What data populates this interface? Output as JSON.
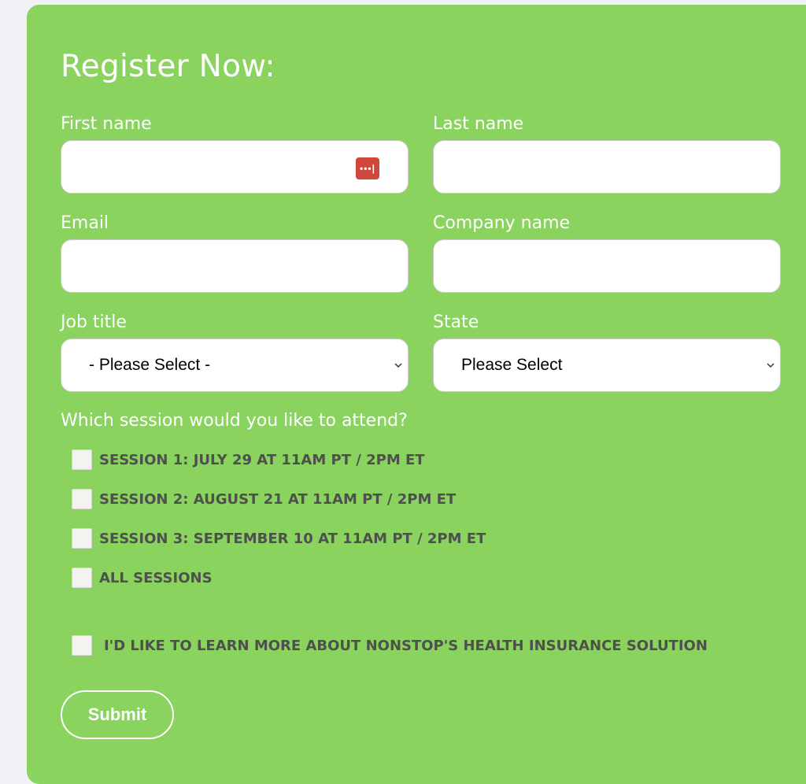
{
  "form": {
    "title": "Register Now:",
    "first_name": {
      "label": "First name",
      "value": "",
      "placeholder": ""
    },
    "last_name": {
      "label": "Last name",
      "value": "",
      "placeholder": ""
    },
    "email": {
      "label": "Email",
      "value": "",
      "placeholder": ""
    },
    "company": {
      "label": "Company name",
      "value": "",
      "placeholder": ""
    },
    "job_title": {
      "label": "Job title",
      "selected": "- Please Select -"
    },
    "state": {
      "label": "State",
      "selected": "Please Select"
    },
    "session_question": "Which session would you like to attend?",
    "sessions": [
      {
        "label": "SESSION 1: JULY 29 AT 11AM PT / 2PM ET",
        "checked": false
      },
      {
        "label": "SESSION 2: AUGUST 21 AT 11AM PT / 2PM ET",
        "checked": false
      },
      {
        "label": "SESSION 3: SEPTEMBER 10 AT 11AM PT / 2PM ET",
        "checked": false
      },
      {
        "label": "ALL SESSIONS",
        "checked": false
      }
    ],
    "learn_more": {
      "label": "I'D LIKE TO LEARN MORE ABOUT NONSTOP'S HEALTH INSURANCE SOLUTION",
      "checked": false
    },
    "submit_label": "Submit",
    "password_manager_icon_text": "•••|"
  },
  "colors": {
    "panel": "#89d35e",
    "page_bg": "#f1f1f6",
    "checkbox_label": "#4f4f4f",
    "password_icon": "#d0473b"
  },
  "icons": {
    "password_manager": "password-manager-icon",
    "select_arrow": "chevron-down-icon"
  }
}
